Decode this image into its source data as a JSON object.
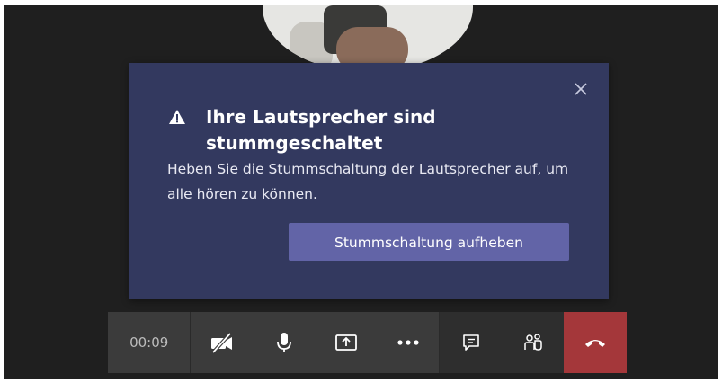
{
  "dialog": {
    "title_line1": "Ihre Lautsprecher sind",
    "title_line2": "stummgeschaltet",
    "body": "Heben Sie die Stummschaltung der Lautsprecher auf, um alle hören zu können.",
    "action_label": "Stummschaltung aufheben",
    "warning_icon": "warning-icon",
    "close_icon": "close-icon"
  },
  "toolbar": {
    "timer": "00:09",
    "buttons": [
      {
        "icon": "camera-off-icon"
      },
      {
        "icon": "microphone-icon"
      },
      {
        "icon": "share-screen-icon"
      },
      {
        "icon": "more-options-icon"
      },
      {
        "icon": "chat-icon"
      },
      {
        "icon": "participants-icon"
      },
      {
        "icon": "hang-up-icon"
      }
    ]
  },
  "colors": {
    "dialog_bg": "#33395f",
    "primary_button": "#6264a7",
    "hangup": "#a4373a",
    "toolbar_bg": "#3b3b3b",
    "stage_bg": "#1f1f1f"
  }
}
